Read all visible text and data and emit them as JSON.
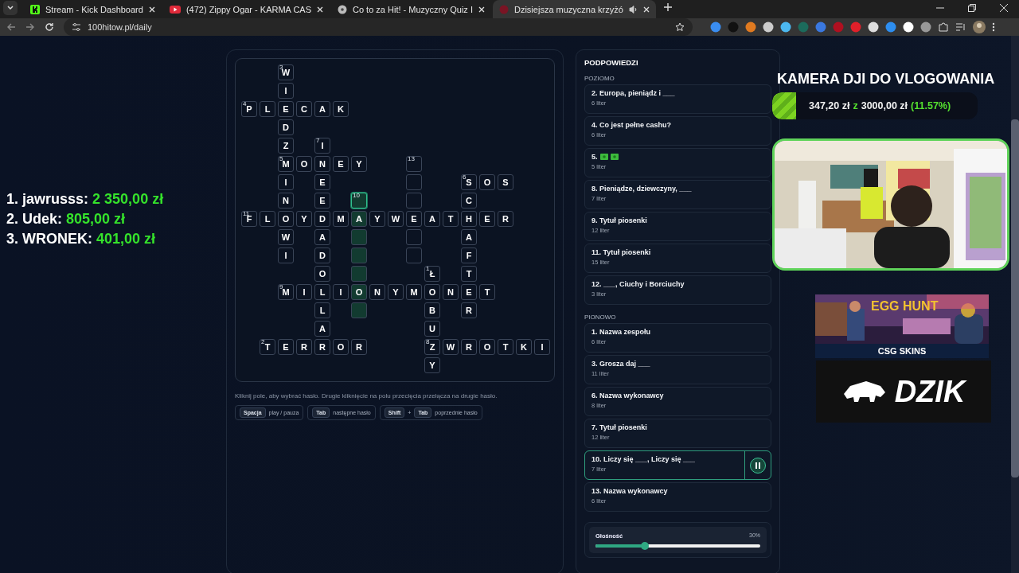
{
  "browser": {
    "tabs": [
      {
        "title": "Stream - Kick Dashboard",
        "selected": false,
        "audio": false
      },
      {
        "title": "(472) Zippy Ogar - KARMA CAS",
        "selected": false,
        "audio": false
      },
      {
        "title": "Co to za Hit! - Muzyczny Quiz I",
        "selected": false,
        "audio": false
      },
      {
        "title": "Dzisiejsza muzyczna krzyżó",
        "selected": true,
        "audio": true
      }
    ],
    "address": "100hitow.pl/daily"
  },
  "leaderboard": [
    {
      "label": "1. jawrusss:",
      "amount": "2 350,00 zł"
    },
    {
      "label": "2. Udek:",
      "amount": "805,00 zł"
    },
    {
      "label": "3. WRONEK:",
      "amount": "401,00 zł"
    }
  ],
  "crossword": {
    "rows": [
      {
        "cells": [
          {
            "kind": "gap"
          },
          {
            "kind": "gap"
          },
          {
            "kind": "letter",
            "letter": "W",
            "number": "3",
            "highlighted": false,
            "selected": false
          },
          {
            "kind": "gap"
          },
          {
            "kind": "gap"
          },
          {
            "kind": "gap"
          },
          {
            "kind": "gap"
          },
          {
            "kind": "gap"
          },
          {
            "kind": "gap"
          },
          {
            "kind": "gap"
          },
          {
            "kind": "gap"
          },
          {
            "kind": "gap"
          },
          {
            "kind": "gap"
          },
          {
            "kind": "gap"
          },
          {
            "kind": "gap"
          },
          {
            "kind": "gap"
          },
          {
            "kind": "gap"
          }
        ]
      },
      {
        "cells": [
          {
            "kind": "gap"
          },
          {
            "kind": "gap"
          },
          {
            "kind": "letter",
            "letter": "I",
            "highlighted": false,
            "selected": false
          },
          {
            "kind": "gap"
          },
          {
            "kind": "gap"
          },
          {
            "kind": "gap"
          },
          {
            "kind": "gap"
          },
          {
            "kind": "gap"
          },
          {
            "kind": "gap"
          },
          {
            "kind": "gap"
          },
          {
            "kind": "gap"
          },
          {
            "kind": "gap"
          },
          {
            "kind": "gap"
          },
          {
            "kind": "gap"
          },
          {
            "kind": "gap"
          },
          {
            "kind": "gap"
          },
          {
            "kind": "gap"
          }
        ]
      },
      {
        "cells": [
          {
            "kind": "letter",
            "letter": "P",
            "number": "4",
            "highlighted": false,
            "selected": false
          },
          {
            "kind": "letter",
            "letter": "L",
            "highlighted": false,
            "selected": false
          },
          {
            "kind": "letter",
            "letter": "E",
            "highlighted": false,
            "selected": false
          },
          {
            "kind": "letter",
            "letter": "C",
            "highlighted": false,
            "selected": false
          },
          {
            "kind": "letter",
            "letter": "A",
            "highlighted": false,
            "selected": false
          },
          {
            "kind": "letter",
            "letter": "K",
            "highlighted": false,
            "selected": false
          },
          {
            "kind": "gap"
          },
          {
            "kind": "gap"
          },
          {
            "kind": "gap"
          },
          {
            "kind": "gap"
          },
          {
            "kind": "gap"
          },
          {
            "kind": "gap"
          },
          {
            "kind": "gap"
          },
          {
            "kind": "gap"
          },
          {
            "kind": "gap"
          },
          {
            "kind": "gap"
          },
          {
            "kind": "gap"
          }
        ]
      },
      {
        "cells": [
          {
            "kind": "gap"
          },
          {
            "kind": "gap"
          },
          {
            "kind": "letter",
            "letter": "D",
            "highlighted": false,
            "selected": false
          },
          {
            "kind": "gap"
          },
          {
            "kind": "gap"
          },
          {
            "kind": "gap"
          },
          {
            "kind": "gap"
          },
          {
            "kind": "gap"
          },
          {
            "kind": "gap"
          },
          {
            "kind": "gap"
          },
          {
            "kind": "gap"
          },
          {
            "kind": "gap"
          },
          {
            "kind": "gap"
          },
          {
            "kind": "gap"
          },
          {
            "kind": "gap"
          },
          {
            "kind": "gap"
          },
          {
            "kind": "gap"
          }
        ]
      },
      {
        "cells": [
          {
            "kind": "gap"
          },
          {
            "kind": "gap"
          },
          {
            "kind": "letter",
            "letter": "Z",
            "highlighted": false,
            "selected": false
          },
          {
            "kind": "gap"
          },
          {
            "kind": "letter",
            "letter": "I",
            "number": "7",
            "highlighted": false,
            "selected": false
          },
          {
            "kind": "gap"
          },
          {
            "kind": "gap"
          },
          {
            "kind": "gap"
          },
          {
            "kind": "gap"
          },
          {
            "kind": "gap"
          },
          {
            "kind": "gap"
          },
          {
            "kind": "gap"
          },
          {
            "kind": "gap"
          },
          {
            "kind": "gap"
          },
          {
            "kind": "gap"
          },
          {
            "kind": "gap"
          },
          {
            "kind": "gap"
          }
        ]
      },
      {
        "cells": [
          {
            "kind": "gap"
          },
          {
            "kind": "gap"
          },
          {
            "kind": "letter",
            "letter": "M",
            "number": "5",
            "highlighted": false,
            "selected": false
          },
          {
            "kind": "letter",
            "letter": "O",
            "highlighted": false,
            "selected": false
          },
          {
            "kind": "letter",
            "letter": "N",
            "highlighted": false,
            "selected": false
          },
          {
            "kind": "letter",
            "letter": "E",
            "highlighted": false,
            "selected": false
          },
          {
            "kind": "letter",
            "letter": "Y",
            "highlighted": false,
            "selected": false
          },
          {
            "kind": "gap"
          },
          {
            "kind": "gap"
          },
          {
            "kind": "empty",
            "number": "13",
            "highlighted": false,
            "selected": false
          },
          {
            "kind": "gap"
          },
          {
            "kind": "gap"
          },
          {
            "kind": "gap"
          },
          {
            "kind": "gap"
          },
          {
            "kind": "gap"
          },
          {
            "kind": "gap"
          },
          {
            "kind": "gap"
          }
        ]
      },
      {
        "cells": [
          {
            "kind": "gap"
          },
          {
            "kind": "gap"
          },
          {
            "kind": "letter",
            "letter": "I",
            "highlighted": false,
            "selected": false
          },
          {
            "kind": "gap"
          },
          {
            "kind": "letter",
            "letter": "E",
            "highlighted": false,
            "selected": false
          },
          {
            "kind": "gap"
          },
          {
            "kind": "gap"
          },
          {
            "kind": "gap"
          },
          {
            "kind": "gap"
          },
          {
            "kind": "empty",
            "highlighted": false,
            "selected": false
          },
          {
            "kind": "gap"
          },
          {
            "kind": "gap"
          },
          {
            "kind": "letter",
            "letter": "S",
            "number": "6",
            "highlighted": false,
            "selected": false
          },
          {
            "kind": "letter",
            "letter": "O",
            "highlighted": false,
            "selected": false
          },
          {
            "kind": "letter",
            "letter": "S",
            "highlighted": false,
            "selected": false
          },
          {
            "kind": "gap"
          },
          {
            "kind": "gap"
          }
        ]
      },
      {
        "cells": [
          {
            "kind": "gap"
          },
          {
            "kind": "gap"
          },
          {
            "kind": "letter",
            "letter": "N",
            "highlighted": false,
            "selected": false
          },
          {
            "kind": "gap"
          },
          {
            "kind": "letter",
            "letter": "E",
            "highlighted": false,
            "selected": false
          },
          {
            "kind": "gap"
          },
          {
            "kind": "empty",
            "number": "10",
            "highlighted": true,
            "selected": true
          },
          {
            "kind": "gap"
          },
          {
            "kind": "gap"
          },
          {
            "kind": "empty",
            "highlighted": false,
            "selected": false
          },
          {
            "kind": "gap"
          },
          {
            "kind": "gap"
          },
          {
            "kind": "letter",
            "letter": "C",
            "highlighted": false,
            "selected": false
          },
          {
            "kind": "gap"
          },
          {
            "kind": "gap"
          },
          {
            "kind": "gap"
          },
          {
            "kind": "gap"
          }
        ]
      },
      {
        "cells": [
          {
            "kind": "letter",
            "letter": "F",
            "number": "11",
            "highlighted": false,
            "selected": false
          },
          {
            "kind": "letter",
            "letter": "L",
            "highlighted": false,
            "selected": false
          },
          {
            "kind": "letter",
            "letter": "O",
            "highlighted": false,
            "selected": false
          },
          {
            "kind": "letter",
            "letter": "Y",
            "highlighted": false,
            "selected": false
          },
          {
            "kind": "letter",
            "letter": "D",
            "highlighted": false,
            "selected": false
          },
          {
            "kind": "letter",
            "letter": "M",
            "highlighted": false,
            "selected": false
          },
          {
            "kind": "letter",
            "letter": "A",
            "highlighted": true,
            "selected": false
          },
          {
            "kind": "letter",
            "letter": "Y",
            "highlighted": false,
            "selected": false
          },
          {
            "kind": "letter",
            "letter": "W",
            "highlighted": false,
            "selected": false
          },
          {
            "kind": "letter",
            "letter": "E",
            "highlighted": false,
            "selected": false
          },
          {
            "kind": "letter",
            "letter": "A",
            "highlighted": false,
            "selected": false
          },
          {
            "kind": "letter",
            "letter": "T",
            "highlighted": false,
            "selected": false
          },
          {
            "kind": "letter",
            "letter": "H",
            "highlighted": false,
            "selected": false
          },
          {
            "kind": "letter",
            "letter": "E",
            "highlighted": false,
            "selected": false
          },
          {
            "kind": "letter",
            "letter": "R",
            "highlighted": false,
            "selected": false
          },
          {
            "kind": "gap"
          },
          {
            "kind": "gap"
          }
        ]
      },
      {
        "cells": [
          {
            "kind": "gap"
          },
          {
            "kind": "gap"
          },
          {
            "kind": "letter",
            "letter": "W",
            "highlighted": false,
            "selected": false
          },
          {
            "kind": "gap"
          },
          {
            "kind": "letter",
            "letter": "A",
            "highlighted": false,
            "selected": false
          },
          {
            "kind": "gap"
          },
          {
            "kind": "empty",
            "highlighted": true,
            "selected": false
          },
          {
            "kind": "gap"
          },
          {
            "kind": "gap"
          },
          {
            "kind": "empty",
            "highlighted": false,
            "selected": false
          },
          {
            "kind": "gap"
          },
          {
            "kind": "gap"
          },
          {
            "kind": "letter",
            "letter": "A",
            "highlighted": false,
            "selected": false
          },
          {
            "kind": "gap"
          },
          {
            "kind": "gap"
          },
          {
            "kind": "gap"
          },
          {
            "kind": "gap"
          }
        ]
      },
      {
        "cells": [
          {
            "kind": "gap"
          },
          {
            "kind": "gap"
          },
          {
            "kind": "letter",
            "letter": "I",
            "highlighted": false,
            "selected": false
          },
          {
            "kind": "gap"
          },
          {
            "kind": "letter",
            "letter": "D",
            "highlighted": false,
            "selected": false
          },
          {
            "kind": "gap"
          },
          {
            "kind": "empty",
            "highlighted": true,
            "selected": false
          },
          {
            "kind": "gap"
          },
          {
            "kind": "gap"
          },
          {
            "kind": "empty",
            "highlighted": false,
            "selected": false
          },
          {
            "kind": "gap"
          },
          {
            "kind": "gap"
          },
          {
            "kind": "letter",
            "letter": "F",
            "highlighted": false,
            "selected": false
          },
          {
            "kind": "gap"
          },
          {
            "kind": "gap"
          },
          {
            "kind": "gap"
          },
          {
            "kind": "gap"
          }
        ]
      },
      {
        "cells": [
          {
            "kind": "gap"
          },
          {
            "kind": "gap"
          },
          {
            "kind": "gap"
          },
          {
            "kind": "gap"
          },
          {
            "kind": "letter",
            "letter": "O",
            "highlighted": false,
            "selected": false
          },
          {
            "kind": "gap"
          },
          {
            "kind": "empty",
            "highlighted": true,
            "selected": false
          },
          {
            "kind": "gap"
          },
          {
            "kind": "gap"
          },
          {
            "kind": "gap"
          },
          {
            "kind": "letter",
            "letter": "Ł",
            "number": "1",
            "highlighted": false,
            "selected": false
          },
          {
            "kind": "gap"
          },
          {
            "kind": "letter",
            "letter": "T",
            "highlighted": false,
            "selected": false
          },
          {
            "kind": "gap"
          },
          {
            "kind": "gap"
          },
          {
            "kind": "gap"
          },
          {
            "kind": "gap"
          }
        ]
      },
      {
        "cells": [
          {
            "kind": "gap"
          },
          {
            "kind": "gap"
          },
          {
            "kind": "letter",
            "letter": "M",
            "number": "9",
            "highlighted": false,
            "selected": false
          },
          {
            "kind": "letter",
            "letter": "I",
            "highlighted": false,
            "selected": false
          },
          {
            "kind": "letter",
            "letter": "L",
            "highlighted": false,
            "selected": false
          },
          {
            "kind": "letter",
            "letter": "I",
            "highlighted": false,
            "selected": false
          },
          {
            "kind": "letter",
            "letter": "O",
            "highlighted": true,
            "selected": false
          },
          {
            "kind": "letter",
            "letter": "N",
            "highlighted": false,
            "selected": false
          },
          {
            "kind": "letter",
            "letter": "Y",
            "highlighted": false,
            "selected": false
          },
          {
            "kind": "letter",
            "letter": "M",
            "highlighted": false,
            "selected": false
          },
          {
            "kind": "letter",
            "letter": "O",
            "highlighted": false,
            "selected": false
          },
          {
            "kind": "letter",
            "letter": "N",
            "highlighted": false,
            "selected": false
          },
          {
            "kind": "letter",
            "letter": "E",
            "highlighted": false,
            "selected": false
          },
          {
            "kind": "letter",
            "letter": "T",
            "highlighted": false,
            "selected": false
          },
          {
            "kind": "gap"
          },
          {
            "kind": "gap"
          },
          {
            "kind": "gap"
          }
        ]
      },
      {
        "cells": [
          {
            "kind": "gap"
          },
          {
            "kind": "gap"
          },
          {
            "kind": "gap"
          },
          {
            "kind": "gap"
          },
          {
            "kind": "letter",
            "letter": "L",
            "highlighted": false,
            "selected": false
          },
          {
            "kind": "gap"
          },
          {
            "kind": "empty",
            "highlighted": true,
            "selected": false
          },
          {
            "kind": "gap"
          },
          {
            "kind": "gap"
          },
          {
            "kind": "gap"
          },
          {
            "kind": "letter",
            "letter": "B",
            "highlighted": false,
            "selected": false
          },
          {
            "kind": "gap"
          },
          {
            "kind": "letter",
            "letter": "R",
            "highlighted": false,
            "selected": false
          },
          {
            "kind": "gap"
          },
          {
            "kind": "gap"
          },
          {
            "kind": "gap"
          },
          {
            "kind": "gap"
          }
        ]
      },
      {
        "cells": [
          {
            "kind": "gap"
          },
          {
            "kind": "gap"
          },
          {
            "kind": "gap"
          },
          {
            "kind": "gap"
          },
          {
            "kind": "letter",
            "letter": "A",
            "highlighted": false,
            "selected": false
          },
          {
            "kind": "gap"
          },
          {
            "kind": "gap"
          },
          {
            "kind": "gap"
          },
          {
            "kind": "gap"
          },
          {
            "kind": "gap"
          },
          {
            "kind": "letter",
            "letter": "U",
            "highlighted": false,
            "selected": false
          },
          {
            "kind": "gap"
          },
          {
            "kind": "gap"
          },
          {
            "kind": "gap"
          },
          {
            "kind": "gap"
          },
          {
            "kind": "gap"
          },
          {
            "kind": "gap"
          }
        ]
      },
      {
        "cells": [
          {
            "kind": "gap"
          },
          {
            "kind": "letter",
            "letter": "T",
            "number": "2",
            "highlighted": false,
            "selected": false
          },
          {
            "kind": "letter",
            "letter": "E",
            "highlighted": false,
            "selected": false
          },
          {
            "kind": "letter",
            "letter": "R",
            "highlighted": false,
            "selected": false
          },
          {
            "kind": "letter",
            "letter": "R",
            "highlighted": false,
            "selected": false
          },
          {
            "kind": "letter",
            "letter": "O",
            "highlighted": false,
            "selected": false
          },
          {
            "kind": "letter",
            "letter": "R",
            "highlighted": false,
            "selected": false
          },
          {
            "kind": "gap"
          },
          {
            "kind": "gap"
          },
          {
            "kind": "gap"
          },
          {
            "kind": "letter",
            "letter": "Z",
            "number": "8",
            "highlighted": false,
            "selected": false
          },
          {
            "kind": "letter",
            "letter": "W",
            "highlighted": false,
            "selected": false
          },
          {
            "kind": "letter",
            "letter": "R",
            "highlighted": false,
            "selected": false
          },
          {
            "kind": "letter",
            "letter": "O",
            "highlighted": false,
            "selected": false
          },
          {
            "kind": "letter",
            "letter": "T",
            "highlighted": false,
            "selected": false
          },
          {
            "kind": "letter",
            "letter": "K",
            "highlighted": false,
            "selected": false
          },
          {
            "kind": "letter",
            "letter": "I",
            "highlighted": false,
            "selected": false
          }
        ]
      },
      {
        "cells": [
          {
            "kind": "gap"
          },
          {
            "kind": "gap"
          },
          {
            "kind": "gap"
          },
          {
            "kind": "gap"
          },
          {
            "kind": "gap"
          },
          {
            "kind": "gap"
          },
          {
            "kind": "gap"
          },
          {
            "kind": "gap"
          },
          {
            "kind": "gap"
          },
          {
            "kind": "gap"
          },
          {
            "kind": "letter",
            "letter": "Y",
            "highlighted": false,
            "selected": false
          },
          {
            "kind": "gap"
          },
          {
            "kind": "gap"
          },
          {
            "kind": "gap"
          },
          {
            "kind": "gap"
          },
          {
            "kind": "gap"
          },
          {
            "kind": "gap"
          }
        ]
      }
    ]
  },
  "instructions": "Kliknij pole, aby wybrać hasło. Drugie kliknięcie na polu przecięcia przełącza na drugie hasło.",
  "shortcuts": [
    {
      "keys": [
        "Spacja"
      ],
      "action": "play / pauza"
    },
    {
      "keys": [
        "Tab"
      ],
      "action": "następne hasło"
    },
    {
      "keys": [
        "Shift",
        "Tab"
      ],
      "joiner": "+",
      "action": "poprzednie hasło"
    }
  ],
  "hints": {
    "title": "PODPOWIEDZI",
    "sections": [
      {
        "heading": "POZIOMO",
        "items": [
          {
            "clue": "2. Europa, pieniądz i ___",
            "length": "6 liter",
            "selected": false
          },
          {
            "clue": "4. Co jest pełne cashu?",
            "length": "6 liter",
            "selected": false
          },
          {
            "clue": "5.",
            "icons": [
              {
                "kind": "banknote"
              },
              {
                "kind": "banknote"
              }
            ],
            "length": "5 liter",
            "selected": false
          },
          {
            "clue": "8. Pieniądze, dziewczyny, ___",
            "length": "7 liter",
            "selected": false
          },
          {
            "clue": "9. Tytuł piosenki",
            "length": "12 liter",
            "selected": false
          },
          {
            "clue": "11. Tytuł piosenki",
            "length": "15 liter",
            "selected": false
          },
          {
            "clue": "12. ___, Ciuchy i Borciuchy",
            "length": "3 liter",
            "selected": false
          }
        ]
      },
      {
        "heading": "PIONOWO",
        "items": [
          {
            "clue": "1. Nazwa zespołu",
            "length": "6 liter",
            "selected": false
          },
          {
            "clue": "3. Grosza daj ___",
            "length": "11 liter",
            "selected": false
          },
          {
            "clue": "6. Nazwa wykonawcy",
            "length": "8 liter",
            "selected": false
          },
          {
            "clue": "7. Tytuł piosenki",
            "length": "12 liter",
            "selected": false
          },
          {
            "clue": "10. Liczy się ___, Liczy się ___",
            "length": "7 liter",
            "selected": true
          },
          {
            "clue": "13. Nazwa wykonawcy",
            "length": "6 liter",
            "selected": false
          }
        ]
      }
    ]
  },
  "volume": {
    "label": "Głośność",
    "reading": "30%",
    "level": 0.3
  },
  "overlay": {
    "goal": {
      "title": "KAMERA DJI DO VLOGOWANIA",
      "raised": "347,20 zł",
      "separator": "z",
      "target": "3000,00 zł",
      "percent": "(11.57%)",
      "level": 0.1157
    },
    "ads": [
      {
        "kind": "egg",
        "title": "EGG HUNT",
        "label": "CSG SKINS"
      },
      {
        "kind": "boar",
        "label": "DZIK"
      }
    ]
  }
}
